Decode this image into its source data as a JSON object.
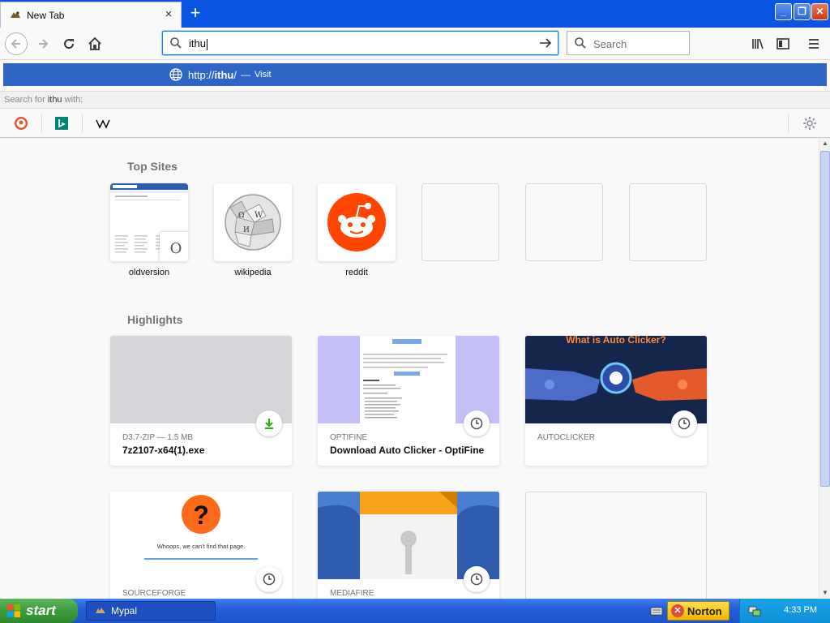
{
  "tab": {
    "title": "New Tab",
    "close_glyph": "×"
  },
  "new_tab_glyph": "+",
  "window_controls": {
    "minimize": "_",
    "maximize": "❐",
    "close": "✕"
  },
  "urlbar": {
    "value": "ithu"
  },
  "searchbar": {
    "placeholder": "Search"
  },
  "suggestion": {
    "url_prefix": "http://",
    "url_bold": "ithu",
    "url_suffix": "/",
    "dash": "—",
    "action": "Visit"
  },
  "search_for": {
    "prefix": "Search for",
    "query": "ithu",
    "suffix": "with:"
  },
  "engines": [
    "duckduckgo-icon",
    "bing-icon",
    "wikipedia-icon"
  ],
  "top_sites": {
    "title": "Top Sites",
    "sites": [
      {
        "label": "oldversion",
        "badge": "O"
      },
      {
        "label": "wikipedia"
      },
      {
        "label": "reddit"
      },
      {
        "label": ""
      },
      {
        "label": ""
      },
      {
        "label": ""
      }
    ]
  },
  "highlights": {
    "title": "Highlights",
    "cards": [
      {
        "meta": "D3.7-ZIP — 1.5 MB",
        "title": "7z2107-x64(1).exe",
        "icon": "download-icon"
      },
      {
        "meta": "OPTIFINE",
        "title": "Download Auto Clicker - OptiFine",
        "icon": "clock-icon"
      },
      {
        "meta": "AUTOCLICKER",
        "title": "",
        "icon": "clock-icon",
        "thumb_text": "What is Auto Clicker?"
      },
      {
        "meta": "SOURCEFORGE",
        "title": "",
        "icon": "clock-icon",
        "thumb_text": "Whoops, we can't find that page."
      },
      {
        "meta": "MEDIAFIRE",
        "title": "",
        "icon": "clock-icon"
      },
      {
        "meta": "",
        "title": ""
      }
    ]
  },
  "taskbar": {
    "start": "start",
    "task": "Mypal",
    "norton": "Norton",
    "time": "4:33 PM"
  },
  "colors": {
    "accent": "#0a84ff",
    "suggestion_bg": "#2e66c7",
    "reddit": "#ff4500",
    "download_green": "#12bc00"
  }
}
